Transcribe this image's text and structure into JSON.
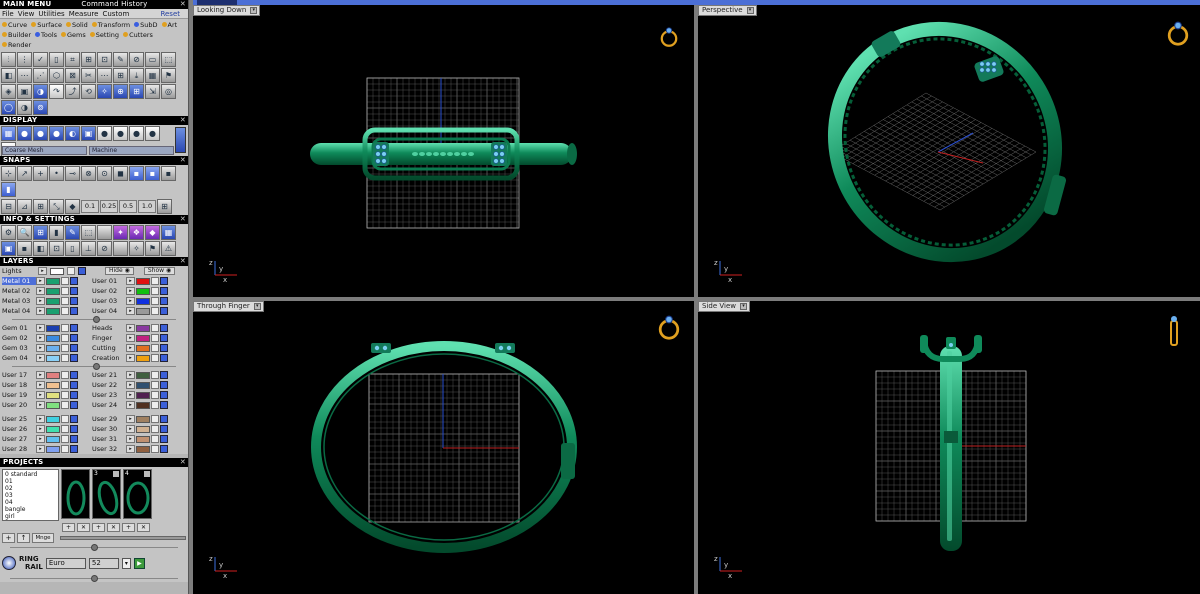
{
  "main_menu": {
    "title": "MAIN MENU",
    "command_history": "Command History"
  },
  "menubar": {
    "items": [
      "File",
      "View",
      "Utilities",
      "Measure",
      "Custom"
    ],
    "reset": "Reset"
  },
  "categories": [
    {
      "label": "Curve",
      "color": "#e0a020"
    },
    {
      "label": "Surface",
      "color": "#e0a020"
    },
    {
      "label": "Solid",
      "color": "#e0a020"
    },
    {
      "label": "Transform",
      "color": "#e0a020"
    },
    {
      "label": "SubD",
      "color": "#3a5ee0"
    },
    {
      "label": "Art",
      "color": "#e0a020"
    },
    {
      "label": "Builder",
      "color": "#e0a020"
    },
    {
      "label": "Tools",
      "color": "#3a5ee0"
    },
    {
      "label": "Gems",
      "color": "#e0a020"
    },
    {
      "label": "Setting",
      "color": "#e0a020"
    },
    {
      "label": "Cutters",
      "color": "#e0a020"
    },
    {
      "label": "Render",
      "color": "#e0a020"
    }
  ],
  "display": {
    "title": "DISPLAY",
    "mesh_dropdown": "Coarse Mesh",
    "machine_dropdown": "Machine"
  },
  "snaps": {
    "title": "SNAPS",
    "values": [
      "0.1",
      "0.25",
      "0.5",
      "1.0"
    ]
  },
  "info_settings": {
    "title": "INFO & SETTINGS"
  },
  "layers": {
    "title": "LAYERS",
    "lights_label": "Lights",
    "hide_label": "Hide",
    "show_label": "Show",
    "group1": [
      {
        "left": "Metal 01",
        "lcolor": "#1aa070",
        "right": "User 01",
        "rcolor": "#e01010",
        "selected": true
      },
      {
        "left": "Metal 02",
        "lcolor": "#1aa070",
        "right": "User 02",
        "rcolor": "#10c010"
      },
      {
        "left": "Metal 03",
        "lcolor": "#1aa070",
        "right": "User 03",
        "rcolor": "#1030e0"
      },
      {
        "left": "Metal 04",
        "lcolor": "#1aa070",
        "right": "User 04",
        "rcolor": "#9a9a9a"
      }
    ],
    "group2": [
      {
        "left": "Gem 01",
        "lcolor": "#1a3fb0",
        "right": "Heads",
        "rcolor": "#8a3aa0"
      },
      {
        "left": "Gem 02",
        "lcolor": "#3a8ae0",
        "right": "Finger",
        "rcolor": "#c02080"
      },
      {
        "left": "Gem 03",
        "lcolor": "#6ab0f0",
        "right": "Cutting",
        "rcolor": "#e07020"
      },
      {
        "left": "Gem 04",
        "lcolor": "#8ad0f8",
        "right": "Creation",
        "rcolor": "#f0a010"
      }
    ],
    "group3": [
      {
        "left": "User 17",
        "lcolor": "#e08080",
        "right": "User 21",
        "rcolor": "#406040"
      },
      {
        "left": "User 18",
        "lcolor": "#f0c090",
        "right": "User 22",
        "rcolor": "#305070"
      },
      {
        "left": "User 19",
        "lcolor": "#e0e080",
        "right": "User 23",
        "rcolor": "#502050"
      },
      {
        "left": "User 20",
        "lcolor": "#80e080",
        "right": "User 24",
        "rcolor": "#503020"
      }
    ],
    "group4": [
      {
        "left": "User 25",
        "lcolor": "#40d0e0",
        "right": "User 29",
        "rcolor": "#a08060"
      },
      {
        "left": "User 26",
        "lcolor": "#40e0b0",
        "right": "User 30",
        "rcolor": "#d0b090"
      },
      {
        "left": "User 27",
        "lcolor": "#60c0f0",
        "right": "User 31",
        "rcolor": "#c09070"
      },
      {
        "left": "User 28",
        "lcolor": "#80a0f0",
        "right": "User 32",
        "rcolor": "#906040"
      }
    ]
  },
  "projects": {
    "title": "PROJECTS",
    "list": [
      "0 standard",
      "01",
      "02",
      "03",
      "04",
      "bangle",
      "girl"
    ],
    "thumb_numbers": [
      "3",
      "4"
    ],
    "manage_label": "Mnge"
  },
  "ringrail": {
    "label_line1": "RING",
    "label_line2": "RAIL",
    "standard": "Euro",
    "size": "52"
  },
  "viewports": [
    {
      "title": "Looking Down"
    },
    {
      "title": "Perspective"
    },
    {
      "title": "Through Finger"
    },
    {
      "title": "Side View"
    }
  ],
  "colors": {
    "model_green": "#0f8a5a",
    "grid": "#a0a0a0",
    "selection_blue": "#4b6fd6"
  }
}
